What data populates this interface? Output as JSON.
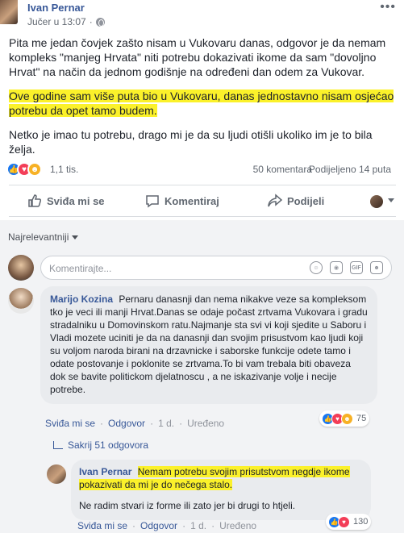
{
  "post": {
    "author": "Ivan Pernar",
    "timestamp": "Jučer u 13:07",
    "paragraph1": "Pita me jedan čovjek zašto nisam u Vukovaru danas, odgovor je da nemam kompleks \"manjeg Hrvata\" niti potrebu dokazivati ikome da sam \"dovoljno Hrvat\" na način da jednom godišnje na određeni dan odem za Vukovar.",
    "paragraph2": "Ove godine sam više puta bio u Vukovaru, danas jednostavno nisam osjećao potrebu da opet tamo budem.",
    "paragraph3": "Netko je imao tu potrebu, drago mi je da su ljudi otišli ukoliko im je to bila želja.",
    "reactions_count": "1,1 tis.",
    "comments_count": "50 komentara",
    "shares_count": "Podijeljeno 14 puta",
    "highlight_color": "#fbf12a"
  },
  "actions": {
    "like": "Sviđa mi se",
    "comment": "Komentiraj",
    "share": "Podijeli"
  },
  "comments": {
    "sort_label": "Najrelevantniji",
    "compose_placeholder": "Komentirajte...",
    "compose_icons": [
      "emoji-icon",
      "camera-icon",
      "gif-icon",
      "sticker-icon"
    ],
    "items": [
      {
        "author": "Marijo Kozina",
        "text": "Pernaru danasnji dan nema nikakve veze sa kompleksom tko je veci ili manji Hrvat.Danas se odaje počast zrtvama Vukovara i gradu stradalniku u Domovinskom ratu.Najmanje sta svi vi koji sjedite u Saboru i Vladi mozete uciniti je da na danasnji dan svojim prisustvom kao ljudi koji su voljom naroda birani na drzavnicke i saborske funkcije odete tamo i odate postovanje i poklonite se zrtvama.To bi vam trebala biti obaveza dok se bavite politickom djelatnoscu , a ne iskazivanje volje i necije potrebe.",
        "like": "Sviđa mi se",
        "reply": "Odgovor",
        "age": "1 d.",
        "edited": "Uređeno",
        "reactions": "75",
        "hide_replies": "Sakrij 51 odgovora"
      },
      {
        "author": "Ivan Pernar",
        "text_highlight": "Nemam potrebu svojim prisutstvom negdje ikome pokazivati da mi je do nečega stalo.",
        "text2": "Ne radim stvari iz forme ili zato jer bi drugi to htjeli.",
        "like": "Sviđa mi se",
        "reply": "Odgovor",
        "age": "1 d.",
        "edited": "Uređeno",
        "reactions": "130"
      }
    ]
  }
}
